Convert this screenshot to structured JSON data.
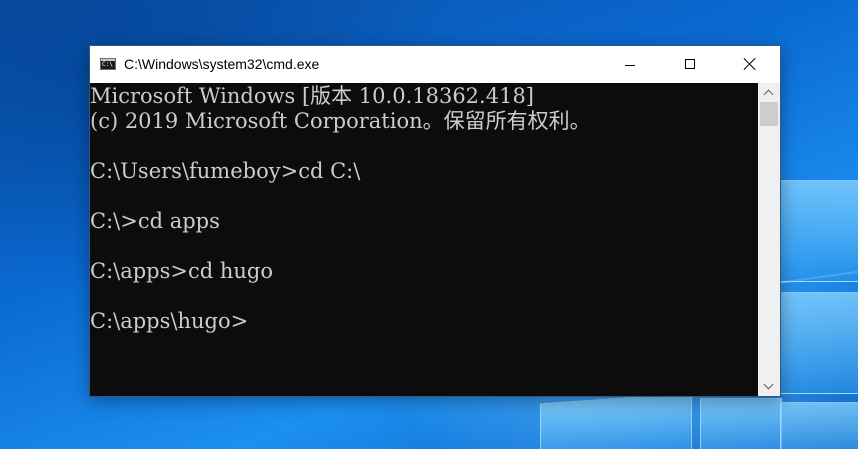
{
  "window": {
    "title": "C:\\Windows\\system32\\cmd.exe",
    "icon": "cmd-app-icon",
    "controls": [
      "minimize-icon",
      "maximize-icon",
      "close-icon"
    ]
  },
  "console": {
    "lines": [
      "Microsoft Windows [版本 10.0.18362.418]",
      "(c) 2019 Microsoft Corporation。保留所有权利。",
      "C:\\Users\\fumeboy>cd C:\\",
      "C:\\>cd apps",
      "C:\\apps>cd hugo",
      "C:\\apps\\hugo>"
    ],
    "foreground": "#cccccc",
    "background": "#0c0c0c"
  },
  "colors": {
    "desktop_accent": "#0a6ad4",
    "titlebar": "#ffffff"
  }
}
